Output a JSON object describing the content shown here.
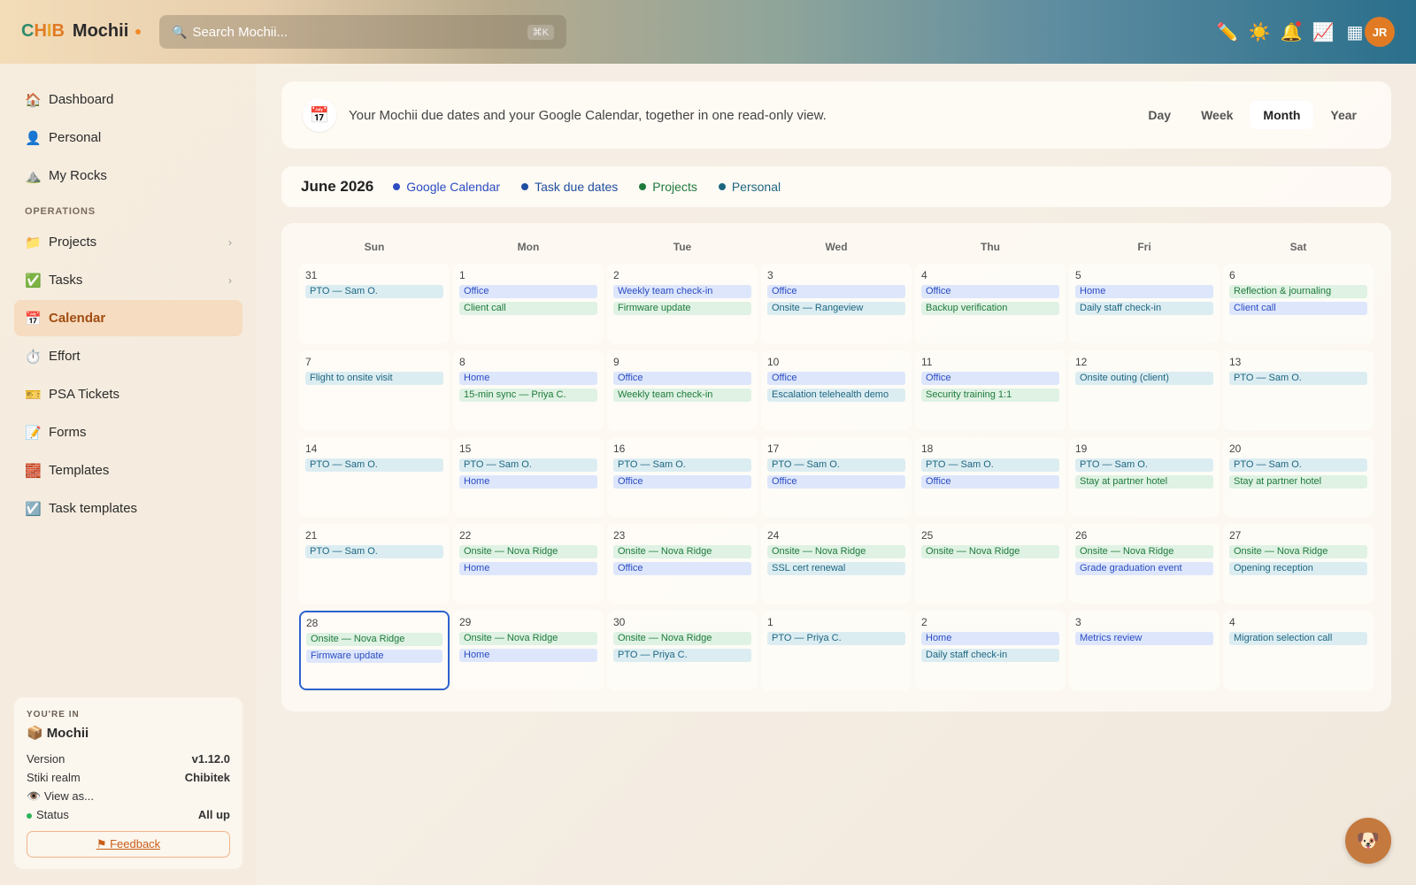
{
  "app": {
    "logo_parts": [
      "C",
      "H",
      "I",
      "B"
    ],
    "name": "Mochii"
  },
  "search": {
    "placeholder": "Search Mochii...",
    "shortcut": "⌘K"
  },
  "header_icons": [
    "pencil-icon",
    "sun-icon",
    "bell-icon",
    "chart-icon",
    "grid-icon"
  ],
  "user": {
    "initials": "JR"
  },
  "sidebar": {
    "items": [
      {
        "label": "Dashboard",
        "icon": "🏠"
      },
      {
        "label": "Personal",
        "icon": "👤"
      },
      {
        "label": "My Rocks",
        "icon": "⛰️"
      }
    ],
    "section_label": "OPERATIONS",
    "ops_items": [
      {
        "label": "Projects",
        "icon": "📁",
        "chevron": "›"
      },
      {
        "label": "Tasks",
        "icon": "✅",
        "chevron": "›"
      },
      {
        "label": "Calendar",
        "icon": "📅"
      },
      {
        "label": "Effort",
        "icon": "⏱️"
      },
      {
        "label": "PSA Tickets",
        "icon": "🎫"
      },
      {
        "label": "Forms",
        "icon": "📝"
      },
      {
        "label": "Templates",
        "icon": "🧱"
      },
      {
        "label": "Task templates",
        "icon": "☑️"
      }
    ]
  },
  "info_card": {
    "heading": "YOU'RE IN",
    "org_icon": "📦",
    "org": "Mochii",
    "version_label": "Version",
    "version": "v1.12.0",
    "realm_label": "Stiki realm",
    "realm": "Chibitek",
    "view_as": "View as...",
    "status_label": "Status",
    "status": "All up",
    "feedback": "⚑ Feedback"
  },
  "banner": {
    "icon": "📅",
    "text": "Your Mochii due dates and your Google Calendar, together in one read-only view.",
    "views": [
      "Day",
      "Week",
      "Month",
      "Year"
    ],
    "active_view": "Month"
  },
  "legend": {
    "month": "June 2026",
    "items": [
      {
        "label": "Google Calendar",
        "color": "#2b4cc2"
      },
      {
        "label": "Task due dates",
        "color": "#1f4fa0"
      },
      {
        "label": "Projects",
        "color": "#1e7a3c"
      },
      {
        "label": "Personal",
        "color": "#1e6680"
      }
    ]
  },
  "calendar": {
    "days_of_week": [
      "Sun",
      "Mon",
      "Tue",
      "Wed",
      "Thu",
      "Fri",
      "Sat"
    ],
    "weeks": [
      [
        {
          "day": "31",
          "events": [
            {
              "t": "PTO — Sam O.",
              "k": "task"
            }
          ]
        },
        {
          "day": "1",
          "events": [
            {
              "t": "Office",
              "k": "gcal"
            },
            {
              "t": "Client call",
              "k": "proj"
            }
          ]
        },
        {
          "day": "2",
          "events": [
            {
              "t": "Weekly team check-in",
              "k": "gcal"
            },
            {
              "t": "Firmware update",
              "k": "proj"
            }
          ]
        },
        {
          "day": "3",
          "events": [
            {
              "t": "Office",
              "k": "gcal"
            },
            {
              "t": "Onsite — Rangeview",
              "k": "task"
            }
          ]
        },
        {
          "day": "4",
          "events": [
            {
              "t": "Office",
              "k": "gcal"
            },
            {
              "t": "Backup verification",
              "k": "proj"
            }
          ]
        },
        {
          "day": "5",
          "events": [
            {
              "t": "Home",
              "k": "gcal"
            },
            {
              "t": "Daily staff check-in",
              "k": "task"
            }
          ]
        },
        {
          "day": "6",
          "events": [
            {
              "t": "Reflection & journaling",
              "k": "pers"
            },
            {
              "t": "Client call",
              "k": "gcal"
            }
          ]
        }
      ],
      [
        {
          "day": "7",
          "events": [
            {
              "t": "Flight to onsite visit",
              "k": "task"
            }
          ]
        },
        {
          "day": "8",
          "events": [
            {
              "t": "Home",
              "k": "gcal"
            },
            {
              "t": "15-min sync — Priya C.",
              "k": "proj"
            }
          ]
        },
        {
          "day": "9",
          "events": [
            {
              "t": "Office",
              "k": "gcal"
            },
            {
              "t": "Weekly team check-in",
              "k": "proj"
            }
          ]
        },
        {
          "day": "10",
          "events": [
            {
              "t": "Office",
              "k": "gcal"
            },
            {
              "t": "Escalation telehealth demo",
              "k": "task"
            }
          ]
        },
        {
          "day": "11",
          "events": [
            {
              "t": "Office",
              "k": "gcal"
            },
            {
              "t": "Security training 1:1",
              "k": "proj"
            }
          ]
        },
        {
          "day": "12",
          "events": [
            {
              "t": "Onsite outing (client)",
              "k": "task"
            }
          ]
        },
        {
          "day": "13",
          "events": [
            {
              "t": "PTO — Sam O.",
              "k": "task"
            }
          ]
        }
      ],
      [
        {
          "day": "14",
          "events": [
            {
              "t": "PTO — Sam O.",
              "k": "task"
            }
          ]
        },
        {
          "day": "15",
          "events": [
            {
              "t": "PTO — Sam O.",
              "k": "task"
            },
            {
              "t": "Home",
              "k": "gcal"
            }
          ]
        },
        {
          "day": "16",
          "events": [
            {
              "t": "PTO — Sam O.",
              "k": "task"
            },
            {
              "t": "Office",
              "k": "gcal"
            }
          ]
        },
        {
          "day": "17",
          "events": [
            {
              "t": "PTO — Sam O.",
              "k": "task"
            },
            {
              "t": "Office",
              "k": "gcal"
            }
          ]
        },
        {
          "day": "18",
          "events": [
            {
              "t": "PTO — Sam O.",
              "k": "task"
            },
            {
              "t": "Office",
              "k": "gcal"
            }
          ]
        },
        {
          "day": "19",
          "events": [
            {
              "t": "PTO — Sam O.",
              "k": "task"
            },
            {
              "t": "Stay at partner hotel",
              "k": "proj"
            }
          ]
        },
        {
          "day": "20",
          "events": [
            {
              "t": "PTO — Sam O.",
              "k": "task"
            },
            {
              "t": "Stay at partner hotel",
              "k": "proj"
            }
          ]
        }
      ],
      [
        {
          "day": "21",
          "events": [
            {
              "t": "PTO — Sam O.",
              "k": "task"
            }
          ]
        },
        {
          "day": "22",
          "events": [
            {
              "t": "Onsite — Nova Ridge",
              "k": "proj"
            },
            {
              "t": "Home",
              "k": "gcal"
            }
          ]
        },
        {
          "day": "23",
          "events": [
            {
              "t": "Onsite — Nova Ridge",
              "k": "proj"
            },
            {
              "t": "Office",
              "k": "gcal"
            }
          ]
        },
        {
          "day": "24",
          "events": [
            {
              "t": "Onsite — Nova Ridge",
              "k": "proj"
            },
            {
              "t": "SSL cert renewal",
              "k": "task"
            }
          ]
        },
        {
          "day": "25",
          "events": [
            {
              "t": "Onsite — Nova Ridge",
              "k": "proj"
            }
          ]
        },
        {
          "day": "26",
          "events": [
            {
              "t": "Onsite — Nova Ridge",
              "k": "proj"
            },
            {
              "t": "Grade graduation event",
              "k": "gcal"
            }
          ]
        },
        {
          "day": "27",
          "events": [
            {
              "t": "Onsite — Nova Ridge",
              "k": "proj"
            },
            {
              "t": "Opening reception",
              "k": "task"
            }
          ]
        }
      ],
      [
        {
          "day": "28",
          "today": true,
          "events": [
            {
              "t": "Onsite — Nova Ridge",
              "k": "proj"
            },
            {
              "t": "Firmware update",
              "k": "gcal"
            }
          ]
        },
        {
          "day": "29",
          "events": [
            {
              "t": "Onsite — Nova Ridge",
              "k": "proj"
            },
            {
              "t": "Home",
              "k": "gcal"
            }
          ]
        },
        {
          "day": "30",
          "events": [
            {
              "t": "Onsite — Nova Ridge",
              "k": "proj"
            },
            {
              "t": "PTO — Priya C.",
              "k": "task"
            }
          ]
        },
        {
          "day": "1",
          "events": [
            {
              "t": "PTO — Priya C.",
              "k": "task"
            }
          ]
        },
        {
          "day": "2",
          "events": [
            {
              "t": "Home",
              "k": "gcal"
            },
            {
              "t": "Daily staff check-in",
              "k": "task"
            }
          ]
        },
        {
          "day": "3",
          "events": [
            {
              "t": "Metrics review",
              "k": "gcal"
            }
          ]
        },
        {
          "day": "4",
          "events": [
            {
              "t": "Migration selection call",
              "k": "task"
            }
          ]
        }
      ]
    ]
  },
  "fab": {
    "icon": "🐶"
  }
}
